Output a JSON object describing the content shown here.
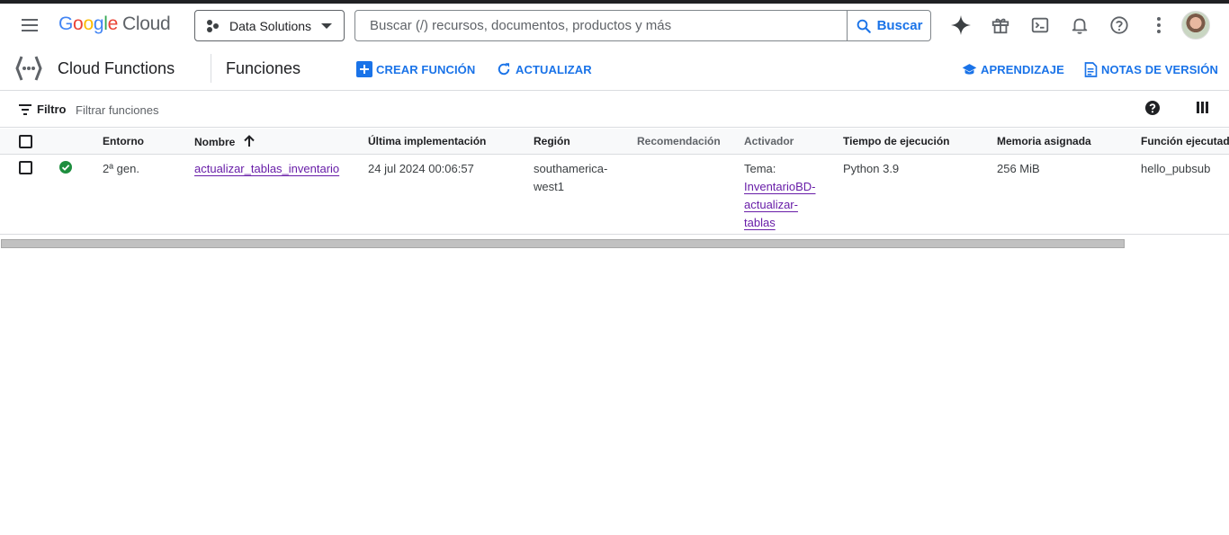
{
  "header": {
    "logo_google": [
      "G",
      "o",
      "o",
      "g",
      "l",
      "e"
    ],
    "logo_cloud": "Cloud",
    "project": "Data Solutions",
    "search_placeholder": "Buscar (/) recursos, documentos, productos y más",
    "search_button": "Buscar"
  },
  "subheader": {
    "product": "Cloud Functions",
    "page": "Funciones",
    "create_label": "CREAR FUNCIÓN",
    "refresh_label": "ACTUALIZAR",
    "learn_label": "APRENDIZAJE",
    "notes_label": "NOTAS DE VERSIÓN"
  },
  "filter": {
    "label": "Filtro",
    "placeholder": "Filtrar funciones"
  },
  "table": {
    "columns": {
      "entorno": "Entorno",
      "nombre": "Nombre",
      "ultima": "Última implementación",
      "region": "Región",
      "recomendacion": "Recomendación",
      "activador": "Activador",
      "tiempo": "Tiempo de ejecución",
      "memoria": "Memoria asignada",
      "funcion": "Función ejecutada"
    },
    "rows": [
      {
        "status": "ok",
        "entorno": "2ª gen.",
        "nombre": "actualizar_tablas_inventario",
        "ultima": "24 jul 2024 00:06:57",
        "region_1": "southamerica-",
        "region_2": "west1",
        "activador_prefix": "Tema:",
        "activador_1": "InventarioBD-",
        "activador_2": "actualizar-",
        "activador_3": "tablas",
        "tiempo": "Python 3.9",
        "memoria": "256 MiB",
        "funcion": "hello_pubsub"
      }
    ]
  },
  "colors": {
    "accent": "#1a73e8",
    "link": "#681da8",
    "success": "#1e8e3e"
  }
}
